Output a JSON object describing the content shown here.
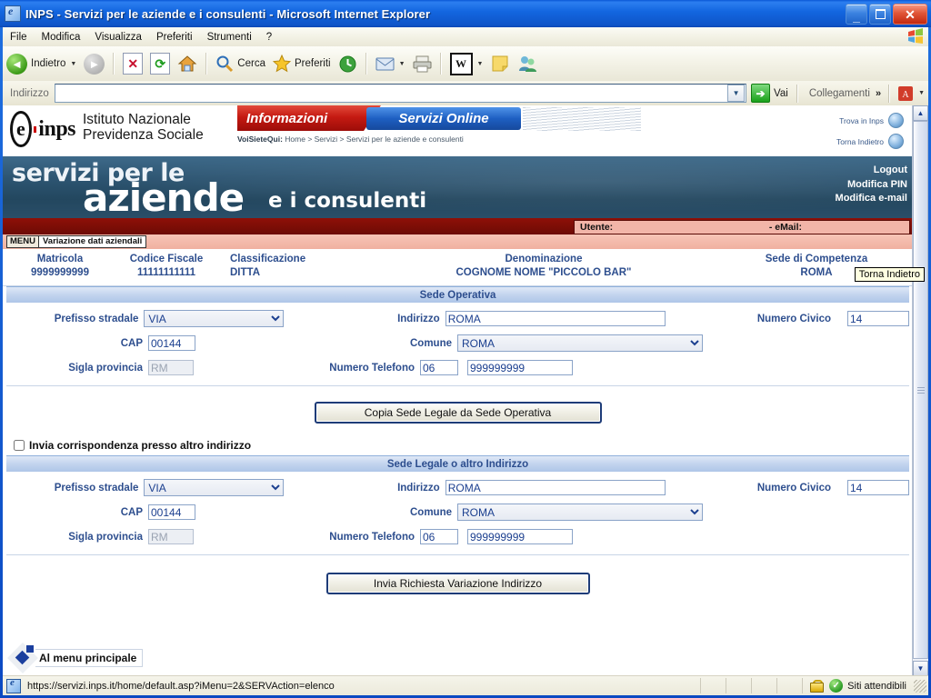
{
  "window": {
    "title": "INPS - Servizi per le aziende e i consulenti - Microsoft Internet Explorer",
    "minimize_label": "_",
    "maximize_label": "□",
    "close_label": "✕"
  },
  "menubar": {
    "items": [
      {
        "label": "File"
      },
      {
        "label": "Modifica"
      },
      {
        "label": "Visualizza"
      },
      {
        "label": "Preferiti"
      },
      {
        "label": "Strumenti"
      },
      {
        "label": "?"
      }
    ]
  },
  "toolbar": {
    "back_label": "Indietro",
    "search_label": "Cerca",
    "favorites_label": "Preferiti",
    "word_label": "W",
    "caret": "▼"
  },
  "address": {
    "label": "Indirizzo",
    "value": "",
    "placeholder": "",
    "go_label": "Vai",
    "go_arrow": "➔",
    "links_label": "Collegamenti",
    "chevron": "»",
    "dropdown_arrow": "▼"
  },
  "site_header": {
    "logo_e": "e",
    "logo_inps": "inps",
    "institute_line1": "Istituto Nazionale",
    "institute_line2": "Previdenza Sociale",
    "tab_informazioni": "Informazioni",
    "tab_servizi_online": "Servizi Online",
    "breadcrumb_prefix": "VoiSieteQui:",
    "breadcrumb": "Home > Servizi > Servizi per le aziende e consulenti",
    "link_trova": "Trova in Inps",
    "link_torna": "Torna Indietro"
  },
  "banner": {
    "line1": "servizi per le",
    "line2": "aziende",
    "line3": "e i consulenti",
    "links": [
      {
        "label": "Logout"
      },
      {
        "label": "Modifica PIN"
      },
      {
        "label": "Modifica e-mail"
      }
    ],
    "tooltip": "Torna Indietro"
  },
  "user_bar": {
    "utente_label": "Utente:",
    "email_label": "- eMail:"
  },
  "menu_strip": {
    "menu_tag": "MENU",
    "current_page": "Variazione dati aziendali"
  },
  "company": {
    "columns": [
      {
        "header": "Matricola",
        "value": "9999999999"
      },
      {
        "header": "Codice Fiscale",
        "value": "11111111111"
      },
      {
        "header": "Classificazione",
        "value": "DITTA"
      },
      {
        "header": "Denominazione",
        "value": "COGNOME NOME \"PICCOLO BAR\""
      },
      {
        "header": "Sede di Competenza",
        "value": "ROMA"
      }
    ]
  },
  "sede_operativa": {
    "section_title": "Sede Operativa",
    "prefisso_label": "Prefisso stradale",
    "prefisso_value": "VIA",
    "indirizzo_label": "Indirizzo",
    "indirizzo_value": "ROMA",
    "civico_label": "Numero Civico",
    "civico_value": "14",
    "cap_label": "CAP",
    "cap_value": "00144",
    "comune_label": "Comune",
    "comune_value": "ROMA",
    "provincia_label": "Sigla provincia",
    "provincia_value": "RM",
    "telefono_label": "Numero Telefono",
    "prefisso_tel_value": "06",
    "telefono_value": "999999999"
  },
  "copy_button": {
    "label": "Copia Sede Legale da Sede Operativa"
  },
  "checkbox": {
    "label": "Invia corrispondenza presso altro indirizzo",
    "checked": false
  },
  "sede_legale": {
    "section_title": "Sede Legale o altro Indirizzo",
    "prefisso_label": "Prefisso stradale",
    "prefisso_value": "VIA",
    "indirizzo_label": "Indirizzo",
    "indirizzo_value": "ROMA",
    "civico_label": "Numero Civico",
    "civico_value": "14",
    "cap_label": "CAP",
    "cap_value": "00144",
    "comune_label": "Comune",
    "comune_value": "ROMA",
    "provincia_label": "Sigla provincia",
    "provincia_value": "RM",
    "telefono_label": "Numero Telefono",
    "prefisso_tel_value": "06",
    "telefono_value": "999999999"
  },
  "submit_button": {
    "label": "Invia Richiesta Variazione Indirizzo"
  },
  "footer_link": {
    "label": "Al menu principale"
  },
  "scrollbar": {
    "up_arrow": "▲",
    "down_arrow": "▼"
  },
  "status_bar": {
    "url": "https://servizi.inps.it/home/default.asp?iMenu=2&SERVAction=elenco",
    "zone_label": "Siti attendibili",
    "check_glyph": "✓"
  },
  "colors": {
    "accent_blue": "#2d4e8e",
    "title_blue": "#1366e0",
    "red_bar": "#8e1008",
    "banner_blue": "#2d5572",
    "section_header": "#aec6e8"
  }
}
